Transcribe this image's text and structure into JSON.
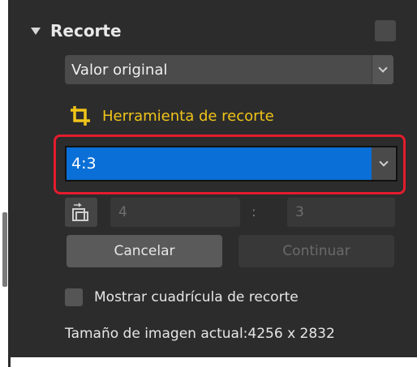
{
  "panel": {
    "title": "Recorte"
  },
  "original_select": {
    "value": "Valor original"
  },
  "crop_tool": {
    "label": "Herramienta de recorte",
    "icon": "crop-icon",
    "accent_color": "#f0c419"
  },
  "ratio_select": {
    "value": "4:3",
    "highlight_color": "#0a6fd6",
    "callout_color": "#e21c2d"
  },
  "dimensions": {
    "width": "4",
    "separator": ":",
    "height": "3",
    "swap_icon": "swap-orientation-icon"
  },
  "buttons": {
    "cancel": "Cancelar",
    "continue": "Continuar"
  },
  "grid_option": {
    "label": "Mostrar cuadrícula de recorte",
    "checked": false
  },
  "image_size": {
    "text": "Tamaño de imagen actual:4256 x 2832"
  }
}
